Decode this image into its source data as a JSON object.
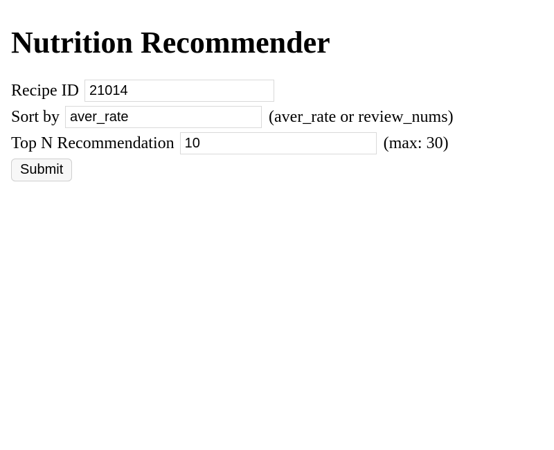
{
  "title": "Nutrition Recommender",
  "form": {
    "recipe_id": {
      "label": "Recipe ID",
      "value": "21014"
    },
    "sort_by": {
      "label": "Sort by",
      "value": "aver_rate",
      "hint": "(aver_rate or review_nums)"
    },
    "top_n": {
      "label": "Top N Recommendation",
      "value": "10",
      "hint": "(max: 30)"
    },
    "submit_label": "Submit"
  }
}
